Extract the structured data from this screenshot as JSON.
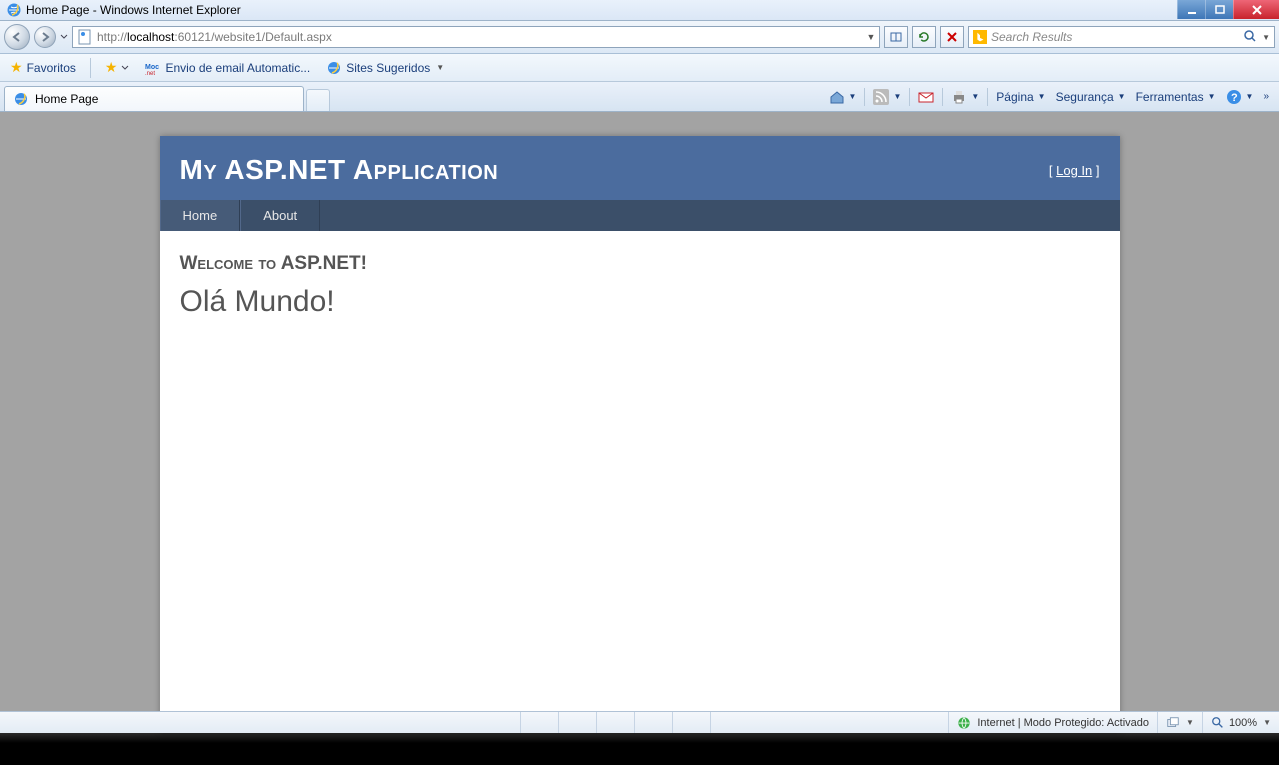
{
  "window": {
    "title": "Home Page - Windows Internet Explorer"
  },
  "address": {
    "url_prefix": "http://",
    "url_host": "localhost",
    "url_rest": ":60121/website1/Default.aspx"
  },
  "search": {
    "placeholder": "Search Results"
  },
  "favbar": {
    "favoritos": "Favoritos",
    "item1": "Envio de email Automatic...",
    "item2": "Sites Sugeridos"
  },
  "tab": {
    "title": "Home Page"
  },
  "cmdbar": {
    "pagina": "Página",
    "seguranca": "Segurança",
    "ferramentas": "Ferramentas"
  },
  "page": {
    "app_title": "My ASP.NET Application",
    "login_text": "Log In",
    "nav_home": "Home",
    "nav_about": "About",
    "welcome": "Welcome to ASP.NET!",
    "hello": "Olá Mundo!"
  },
  "status": {
    "zone": "Internet | Modo Protegido: Activado",
    "zoom": "100%"
  }
}
